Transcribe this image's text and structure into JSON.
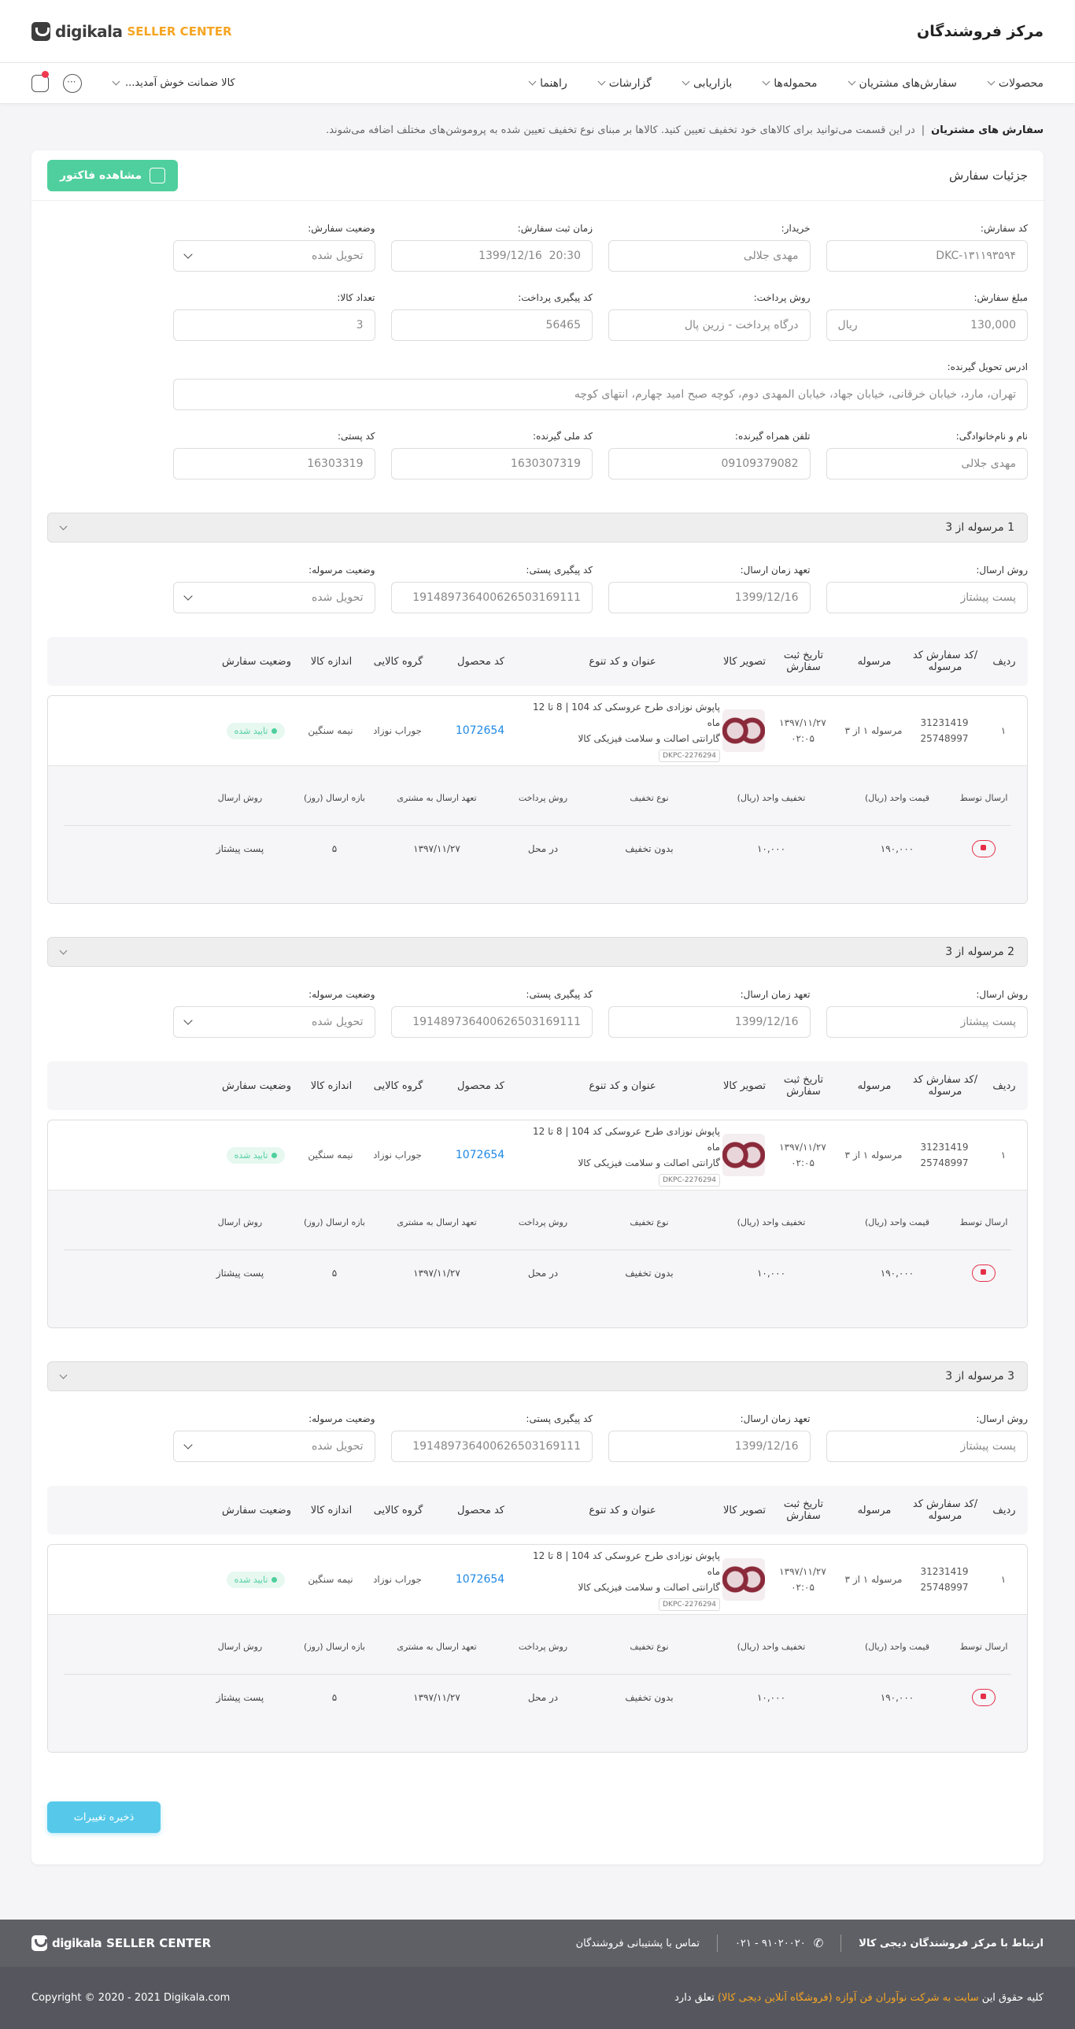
{
  "header": {
    "title": "مرکز فروشندگان",
    "logo_main": "digikala",
    "logo_sub": "SELLER CENTER"
  },
  "nav": {
    "items": [
      "محصولات",
      "سفارش‌های مشتریان",
      "محموله‌ها",
      "بازاریابی",
      "گزارشات",
      "راهنما"
    ],
    "guarantee": "کالا ضمانت خوش آمدید..."
  },
  "breadcrumb": {
    "title": "سفارش های مشتریان",
    "desc": "در این قسمت می‌توانید برای کالاهای خود تخفیف تعیین کنید. کالاها بر مبنای نوع تخفیف تعیین شده به پروموشن‌های مختلف اضافه می‌شوند."
  },
  "card": {
    "title": "جزئیات سفارش",
    "invoice_btn": "مشاهده فاکتور"
  },
  "order": {
    "labels": {
      "code": "کد سفارش:",
      "buyer": "خریدار:",
      "time": "زمان ثبت سفارش:",
      "status": "وضعیت سفارش:",
      "amount": "مبلغ سفارش:",
      "pay_method": "روش پرداخت:",
      "pay_track": "کد پیگیری پرداخت:",
      "count": "تعداد کالا:",
      "address": "ادرس تحویل گیرنده:",
      "name": "نام و نام‌خانوادگی:",
      "phone": "تلفن همراه گیرنده:",
      "nid": "کد ملی گیرنده:",
      "postal": "کد پستی:"
    },
    "code": "DKC-۱۳۱۱۹۳۵۹۴",
    "buyer": "مهدی جلالی",
    "time": "1399/12/16  20:30",
    "status": "تحویل شده",
    "amount": "130,000",
    "currency": "ریال",
    "pay_method": "درگاه پرداخت - زرین پال",
    "pay_track": "56465",
    "count": "3",
    "address": "تهران، مارد، خیابان خرقانی، خیابان جهاد، خیابان المهدی دوم، کوچه صبح امید چهارم، انتهای کوچه",
    "name": "مهدی جلالی",
    "phone": "09109379082",
    "nid": "1630307319",
    "postal": "16303319"
  },
  "pkg_labels": {
    "method": "روش ارسال:",
    "commit": "تعهد زمان ارسال:",
    "track": "کد پیگیری پستی:",
    "status": "وضعیت مرسوله:"
  },
  "table_head": [
    "ردیف",
    "/کد سفارش کد مرسوله",
    "مرسوله",
    "تاریخ ثبت سفارش",
    "تصویر کالا",
    "عنوان و کد تنوع",
    "کد محصول",
    "گروه کالایی",
    "اندازه کالا",
    "وضعیت سفارش"
  ],
  "sub_head": [
    "ارسال توسط",
    "قیمت واحد (ریال)",
    "تخفیف واحد (ریال)",
    "نوع تخفیف",
    "روش پرداخت",
    "تعهد ارسال به مشتری",
    "بازه ارسال (روز)",
    "روش ارسال"
  ],
  "packages": [
    {
      "title": "1 مرسوله از 3",
      "method": "پست پیشتاز",
      "commit": "1399/12/16",
      "track": "19148973640062650316911‪1",
      "status": "تحویل شده",
      "row": {
        "num": "۱",
        "order_code": "31231419",
        "pack_code": "25748997",
        "pack": "مرسوله ۱ از ۳",
        "date": "۱۳۹۷/۱۱/۲۷",
        "time": "۰۲:۰۵",
        "title1": "پاپوش نوزادی طرح عروسکی کد 104 | 8 تا 12 ماه",
        "title2": "گارانتی اصالت و سلامت فیزیکی کالا",
        "sku": "DKPC-2276294",
        "pcode": "1072654",
        "group": "جوراب نوزاد",
        "size": "نیمه سنگین",
        "status": "تایید شده"
      },
      "sub": {
        "price": "۱۹۰,۰۰۰",
        "discount": "۱۰,۰۰۰",
        "disc_type": "بدون تخفیف",
        "pay": "در محل",
        "commit": "۱۳۹۷/۱۱/۲۷",
        "range": "۵",
        "method": "پست پیشتاز"
      }
    },
    {
      "title": "2 مرسوله از 3",
      "method": "پست پیشتاز",
      "commit": "1399/12/16",
      "track": "19148973640062650316911‪1",
      "status": "تحویل شده",
      "row": {
        "num": "۱",
        "order_code": "31231419",
        "pack_code": "25748997",
        "pack": "مرسوله ۱ از ۳",
        "date": "۱۳۹۷/۱۱/۲۷",
        "time": "۰۲:۰۵",
        "title1": "پاپوش نوزادی طرح عروسکی کد 104 | 8 تا 12 ماه",
        "title2": "گارانتی اصالت و سلامت فیزیکی کالا",
        "sku": "DKPC-2276294",
        "pcode": "1072654",
        "group": "جوراب نوزاد",
        "size": "نیمه سنگین",
        "status": "تایید شده"
      },
      "sub": {
        "price": "۱۹۰,۰۰۰",
        "discount": "۱۰,۰۰۰",
        "disc_type": "بدون تخفیف",
        "pay": "در محل",
        "commit": "۱۳۹۷/۱۱/۲۷",
        "range": "۵",
        "method": "پست پیشتاز"
      }
    },
    {
      "title": "3 مرسوله از 3",
      "method": "پست پیشتاز",
      "commit": "1399/12/16",
      "track": "19148973640062650316911‪1",
      "status": "تحویل شده",
      "row": {
        "num": "۱",
        "order_code": "31231419",
        "pack_code": "25748997",
        "pack": "مرسوله ۱ از ۳",
        "date": "۱۳۹۷/۱۱/۲۷",
        "time": "۰۲:۰۵",
        "title1": "پاپوش نوزادی طرح عروسکی کد 104 | 8 تا 12 ماه",
        "title2": "گارانتی اصالت و سلامت فیزیکی کالا",
        "sku": "DKPC-2276294",
        "pcode": "1072654",
        "group": "جوراب نوزاد",
        "size": "نیمه سنگین",
        "status": "تایید شده"
      },
      "sub": {
        "price": "۱۹۰,۰۰۰",
        "discount": "۱۰,۰۰۰",
        "disc_type": "بدون تخفیف",
        "pay": "در محل",
        "commit": "۱۳۹۷/۱۱/۲۷",
        "range": "۵",
        "method": "پست پیشتاز"
      }
    }
  ],
  "save_btn": "ذخیره تغییرات",
  "footer": {
    "contact": "ارتباط با مرکز فروشندگان دیجی کالا",
    "phone": "۰۲۱ - ۹۱۰۲۰۰۲۰",
    "support": "تماس با پشتیبانی فروشندگان",
    "rights_pre": "کلیه حقوق این",
    "rights_link": "سایت به شرکت نوآوران فن آوازه (فروشگاه آنلاین دیجی کالا)",
    "rights_post": "تعلق دارد",
    "copyright": "Copyright © 2020 - 2021 Digikala.com"
  }
}
